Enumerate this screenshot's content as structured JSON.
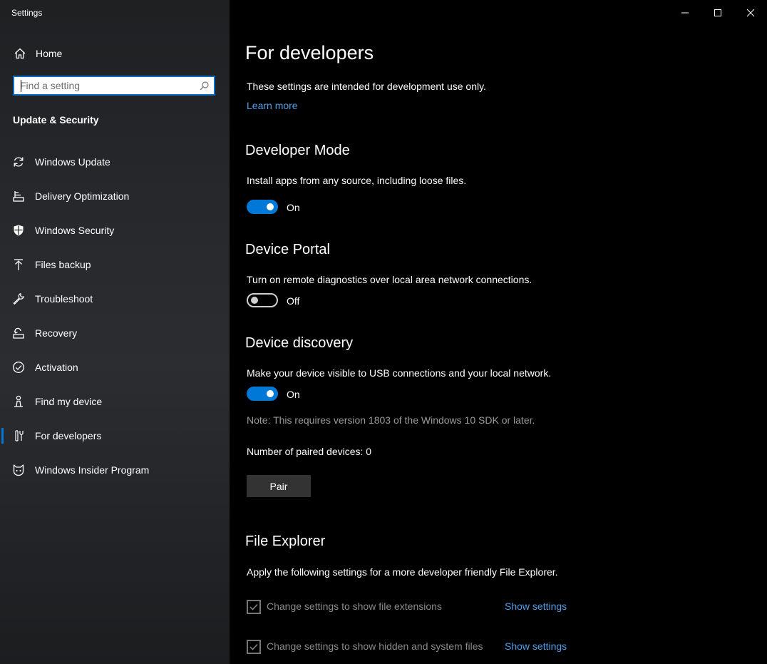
{
  "window": {
    "app_title": "Settings",
    "accent_color": "#0078d7",
    "link_color": "#4f9fe8"
  },
  "sidebar": {
    "home_label": "Home",
    "search_placeholder": "Find a setting",
    "section_heading": "Update & Security",
    "items": [
      {
        "label": "Windows Update",
        "icon": "sync-icon"
      },
      {
        "label": "Delivery Optimization",
        "icon": "delivery-optimization-icon"
      },
      {
        "label": "Windows Security",
        "icon": "shield-icon"
      },
      {
        "label": "Files backup",
        "icon": "upload-arrow-icon"
      },
      {
        "label": "Troubleshoot",
        "icon": "wrench-icon"
      },
      {
        "label": "Recovery",
        "icon": "recovery-icon"
      },
      {
        "label": "Activation",
        "icon": "check-circle-icon"
      },
      {
        "label": "Find my device",
        "icon": "person-location-icon"
      },
      {
        "label": "For developers",
        "icon": "developer-tools-icon",
        "selected": true
      },
      {
        "label": "Windows Insider Program",
        "icon": "insider-cat-icon"
      }
    ]
  },
  "main": {
    "title": "For developers",
    "intro": "These settings are intended for development use only.",
    "learn_more": "Learn more",
    "developer_mode": {
      "heading": "Developer Mode",
      "description": "Install apps from any source, including loose files.",
      "state": "On"
    },
    "device_portal": {
      "heading": "Device Portal",
      "description": "Turn on remote diagnostics over local area network connections.",
      "state": "Off"
    },
    "device_discovery": {
      "heading": "Device discovery",
      "description": "Make your device visible to USB connections and your local network.",
      "state": "On",
      "note": "Note: This requires version 1803 of the Windows 10 SDK or later.",
      "paired_devices": "Number of paired devices: 0",
      "pair_button": "Pair"
    },
    "file_explorer": {
      "heading": "File Explorer",
      "description": "Apply the following settings for a more developer friendly File Explorer.",
      "options": [
        {
          "label": "Change settings to show file extensions",
          "link": "Show settings",
          "checked": true
        },
        {
          "label": "Change settings to show hidden and system files",
          "link": "Show settings",
          "checked": true
        }
      ]
    }
  }
}
